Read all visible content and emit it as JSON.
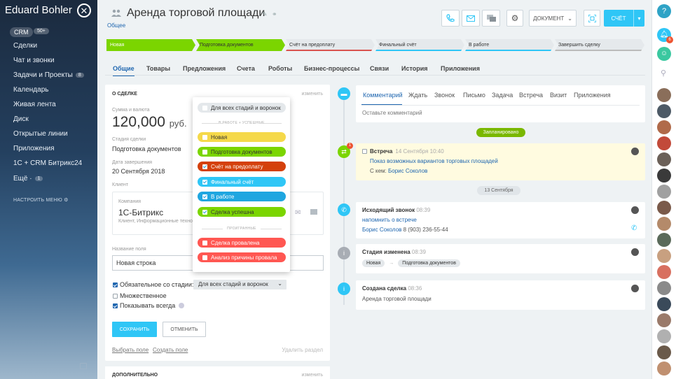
{
  "left_sidebar": {
    "user_name": "Eduard Bohler",
    "crm": "CRM",
    "crm_count": "50+",
    "items": [
      {
        "label": "Сделки",
        "badge": ""
      },
      {
        "label": "Чат и звонки",
        "badge": ""
      },
      {
        "label": "Задачи и Проекты",
        "badge": "8"
      },
      {
        "label": "Календарь",
        "badge": ""
      },
      {
        "label": "Живая лента",
        "badge": ""
      },
      {
        "label": "Диск",
        "badge": ""
      },
      {
        "label": "Открытые линии",
        "badge": ""
      },
      {
        "label": "Приложения",
        "badge": ""
      },
      {
        "label": "1С + CRM Битрикс24",
        "badge": ""
      },
      {
        "label": "Ещё ·",
        "badge": "1"
      }
    ],
    "configure": "НАСТРОИТЬ МЕНЮ"
  },
  "header": {
    "title": "Аренда торговой площади",
    "subtitle": "Общее",
    "document_label": "ДОКУМЕНТ",
    "invoice_label": "СЧЁТ"
  },
  "stages": [
    {
      "label": "Новая",
      "color": "#7bd500",
      "text": "#fff"
    },
    {
      "label": "Подготовка документов",
      "color": "#7bd500",
      "text": "#333"
    },
    {
      "label": "Счёт на предоплату",
      "color": "#e5e9ec",
      "line": "#d9534f",
      "text": "#333"
    },
    {
      "label": "Финальный счёт",
      "color": "#e5e9ec",
      "line": "#2fc6f6",
      "text": "#333"
    },
    {
      "label": "В работе",
      "color": "#e5e9ec",
      "line": "#2fc6f6",
      "text": "#333"
    },
    {
      "label": "Завершить сделку",
      "color": "#e5e9ec",
      "line": "#bbb",
      "text": "#333"
    }
  ],
  "tabs": [
    "Общие",
    "Товары",
    "Предложения",
    "Счета",
    "Роботы",
    "Бизнес-процессы",
    "Связи",
    "История",
    "Приложения"
  ],
  "about": {
    "header": "О СДЕЛКЕ",
    "edit": "изменить",
    "sum_label": "Сумма и валюта",
    "sum_value": "120,000",
    "currency": "руб.",
    "stage_label": "Стадия сделки",
    "stage_value": "Подготовка документов",
    "date_label": "Дата завершения",
    "date_value": "20 Сентября 2018",
    "client_label": "Клиент",
    "company_label": "Компания",
    "company_name": "1С-Битрикс",
    "company_desc": "Клиент, Информационные техно",
    "field_name_label": "Название поля",
    "field_value": "Новая строка",
    "required_label": "Обязательное со стадии:",
    "required_select": "Для всех стадий и воронок",
    "multiple_label": "Множественное",
    "always_label": "Показывать всегда",
    "save": "СОХРАНИТЬ",
    "cancel": "ОТМЕНИТЬ",
    "select_field": "Выбрать поле",
    "create_field": "Создать поле",
    "delete_section": "Удалить раздел"
  },
  "extra": {
    "header": "ДОПОЛНИТЕЛЬНО",
    "edit": "изменить"
  },
  "dropdown": {
    "all": "Для всех стадий и воронок",
    "section_success": "В РАБОТЕ + УСПЕШНЫЕ",
    "section_lost": "ПРОИГРАННЫЕ",
    "options": [
      {
        "label": "Новая",
        "color": "#f5d94a",
        "text": "#333",
        "checked": false
      },
      {
        "label": "Подготовка документов",
        "color": "#7bd500",
        "text": "#333",
        "checked": false
      },
      {
        "label": "Счёт на предоплату",
        "color": "#d4400b",
        "text": "#fff",
        "checked": true
      },
      {
        "label": "Финальный счёт",
        "color": "#2fc6f6",
        "text": "#fff",
        "checked": true
      },
      {
        "label": "В работе",
        "color": "#1fa6e0",
        "text": "#fff",
        "checked": true
      },
      {
        "label": "Сделка успешна",
        "color": "#7bd500",
        "text": "#333",
        "checked": true
      }
    ],
    "lost_options": [
      {
        "label": "Сделка провалена",
        "color": "#ff5752",
        "text": "#fff",
        "checked": false
      },
      {
        "label": "Анализ причины провала",
        "color": "#ff5752",
        "text": "#fff",
        "checked": false
      }
    ]
  },
  "feed": {
    "comment_tabs": [
      "Комментарий",
      "Ждать",
      "Звонок",
      "Письмо",
      "Задача",
      "Встреча",
      "Визит",
      "Приложения"
    ],
    "comment_placeholder": "Оставьте комментарий",
    "planned": "Запланировано",
    "meeting": {
      "title": "Встреча",
      "time": "14 Сентября 10:40",
      "link": "Показ возможных вариантов торговых площадей",
      "with_label": "С кем:",
      "with_name": "Борис Соколов",
      "badge": "1"
    },
    "date_pill": "13 Сентября",
    "call": {
      "title": "Исходящий звонок",
      "time": "08:39",
      "link": "напомнить о встрече",
      "person": "Борис Соколов",
      "phone": "8 (903) 236-55-44"
    },
    "stage": {
      "title": "Стадия изменена",
      "time": "08:39",
      "from": "Новая",
      "to": "Подготовка документов"
    },
    "created": {
      "title": "Создана сделка",
      "time": "08:36",
      "text": "Аренда торговой площади"
    }
  },
  "right_bar": {
    "help": "?",
    "notif_badge": "6"
  }
}
